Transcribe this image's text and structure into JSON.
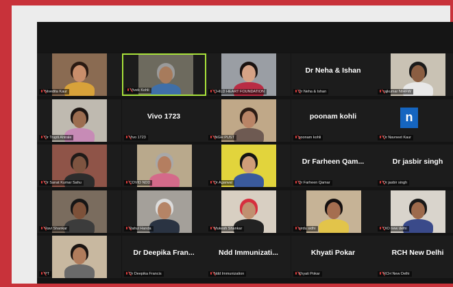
{
  "meeting": {
    "participants": [
      {
        "name": "Nivedita Kaur",
        "big": "",
        "video": true,
        "bg": "#8a6b52",
        "skin": "#c98e6b",
        "hair": "#2a1a12",
        "shirt": "#d8a23a"
      },
      {
        "name": "Vivek Kohli",
        "big": "",
        "video": true,
        "active": true,
        "bg": "#6d6a5e",
        "skin": "#a77b5c",
        "hair": "#9a9a9a",
        "shirt": "#3f6fa8"
      },
      {
        "name": "CHILD HEART FOUNDATION",
        "big": "",
        "video": true,
        "bg": "#9a9ea4",
        "skin": "#d6a386",
        "hair": "#1a1210",
        "shirt": "#b92c44"
      },
      {
        "name": "Dr Neha & Ishan",
        "big": "Dr Neha & Ishan",
        "video": false
      },
      {
        "name": "rajkumar NIHFW",
        "big": "",
        "video": true,
        "bg": "#c9c2b4",
        "skin": "#8b5e42",
        "hair": "#1a1a1a",
        "shirt": "#e8e8e8"
      },
      {
        "name": "Dr Trupti Ahirale",
        "big": "",
        "video": true,
        "bg": "#bfbab0",
        "skin": "#9c6d50",
        "hair": "#1b1411",
        "shirt": "#c78bb6"
      },
      {
        "name": "Vivo 1723",
        "big": "Vivo 1723",
        "video": false
      },
      {
        "name": "INGH PUST",
        "big": "",
        "video": true,
        "bg": "#c0a888",
        "skin": "#b98466",
        "hair": "#2b1c14",
        "shirt": "#6e5a52"
      },
      {
        "name": "poonam kohli",
        "big": "poonam kohli",
        "video": false
      },
      {
        "name": "Dr Navneet Kaur",
        "big": "",
        "video": false,
        "logo": "n"
      },
      {
        "name": "Dr Sanat Kumar Sahu",
        "big": "",
        "video": true,
        "bg": "#8f5448",
        "skin": "#7e5440",
        "hair": "#1f1a18",
        "shirt": "#2c2c2c"
      },
      {
        "name": "COVID NDD",
        "big": "",
        "video": true,
        "bg": "#b9a98c",
        "skin": "#b47e60",
        "hair": "#a8a8a8",
        "shirt": "#d46a8a"
      },
      {
        "name": "Dr Agarwal",
        "big": "",
        "video": true,
        "bg": "#e2d43c",
        "skin": "#d09d78",
        "hair": "#141414",
        "shirt": "#3a5a9c"
      },
      {
        "name": "Dr Farheen Qamar",
        "big": "Dr Farheen Qam...",
        "video": false
      },
      {
        "name": "Dr jasbir singh",
        "big": "Dr jasbir singh",
        "video": false
      },
      {
        "name": "Ravi Shankar",
        "big": "",
        "video": true,
        "bg": "#7a6c5e",
        "skin": "#7d5139",
        "hair": "#151515",
        "shirt": "#3c3c3c"
      },
      {
        "name": "Rahul Handa",
        "big": "",
        "video": true,
        "bg": "#a4a09a",
        "skin": "#b58466",
        "hair": "#dcdcdc",
        "shirt": "#2a3342"
      },
      {
        "name": "Mukesh Shankar",
        "big": "",
        "video": true,
        "bg": "#d8cfc2",
        "skin": "#c09070",
        "hair": "#d62e3e",
        "shirt": "#222222"
      },
      {
        "name": "nirdu sidhi",
        "big": "",
        "video": true,
        "bg": "#c6b396",
        "skin": "#a56e50",
        "hair": "#141010",
        "shirt": "#e2c44a"
      },
      {
        "name": "DIO new delhi",
        "big": "",
        "video": true,
        "bg": "#d9d4cc",
        "skin": "#9d6a4c",
        "hair": "#181818",
        "shirt": "#3a4a8a"
      },
      {
        "name": "PT",
        "big": "",
        "video": true,
        "bg": "#c8b8a0",
        "skin": "#b07c5c",
        "hair": "#1a1412",
        "shirt": "#6a6a6a"
      },
      {
        "name": "Dr Deepika Francis",
        "big": "Dr  Deepika Fran...",
        "video": false
      },
      {
        "name": "Ndd Immunization",
        "big": "Ndd  Immunizati...",
        "video": false
      },
      {
        "name": "Khyati Pokar",
        "big": "Khyati Pokar",
        "video": false
      },
      {
        "name": "RCH New Delhi",
        "big": "RCH  New Delhi",
        "video": false
      }
    ]
  }
}
